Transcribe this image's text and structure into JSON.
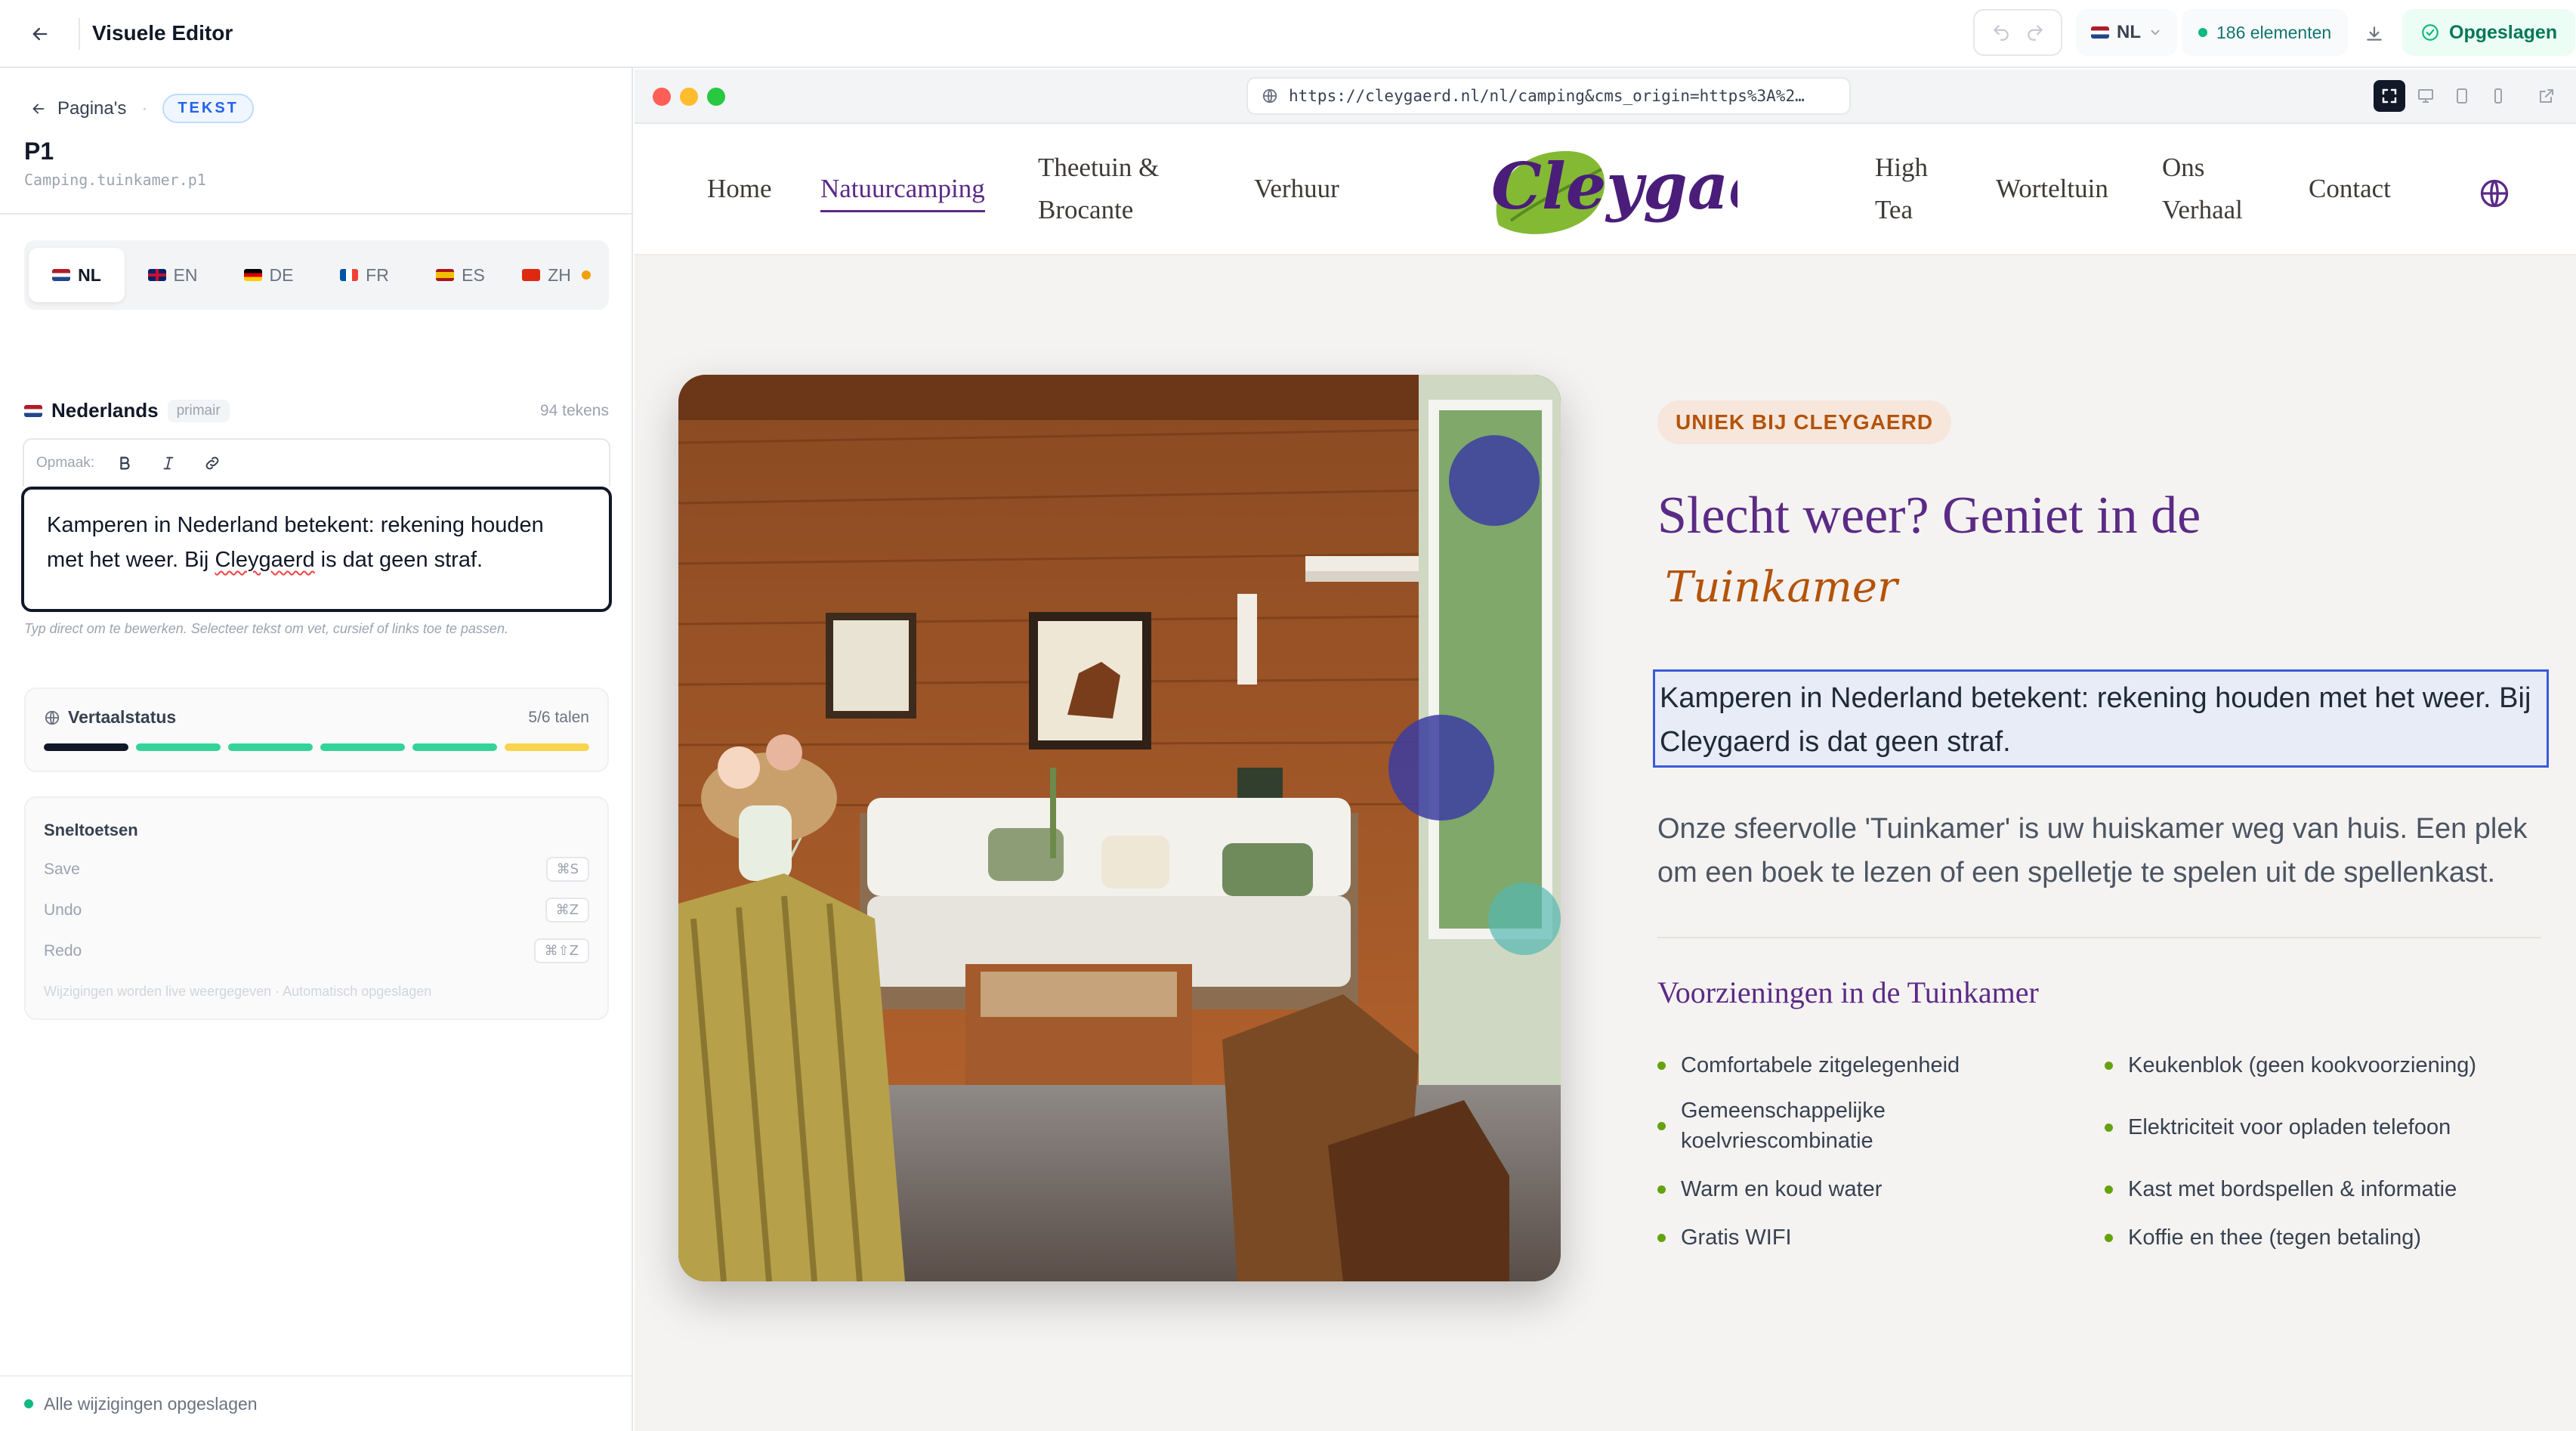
{
  "topbar": {
    "title": "Visuele Editor",
    "language": "NL",
    "element_count": "186 elementen",
    "saved_label": "Opgeslagen"
  },
  "editor": {
    "breadcrumb": "Pagina's",
    "type_badge": "TEKST",
    "element_title": "P1",
    "element_path": "Camping.tuinkamer.p1",
    "languages": [
      {
        "code": "NL",
        "active": true
      },
      {
        "code": "EN"
      },
      {
        "code": "DE"
      },
      {
        "code": "FR"
      },
      {
        "code": "ES"
      },
      {
        "code": "ZH",
        "warning": true
      }
    ],
    "current_language": "Nederlands",
    "primary_badge": "primair",
    "char_count": "94 tekens",
    "format_label": "Opmaak:",
    "text_part1": "Kamperen in Nederland betekent: rekening houden met het weer. Bij ",
    "text_word": "Cleygaerd",
    "text_part2": " is dat geen straf.",
    "hint": "Typ direct om te bewerken. Selecteer tekst om vet, cursief of links toe te passen.",
    "translation_status": {
      "title": "Vertaalstatus",
      "count": "5/6 talen",
      "bar_colors": [
        "#111827",
        "#34d399",
        "#34d399",
        "#34d399",
        "#34d399",
        "#fcd34d"
      ]
    },
    "shortcuts": {
      "title": "Sneltoetsen",
      "items": [
        {
          "label": "Save",
          "keys": "⌘S"
        },
        {
          "label": "Undo",
          "keys": "⌘Z"
        },
        {
          "label": "Redo",
          "keys": "⌘⇧Z"
        }
      ],
      "footer": "Wijzigingen worden live weergegeven · Automatisch opgeslagen"
    },
    "footer_status": "Alle wijzigingen opgeslagen"
  },
  "preview": {
    "url": "https://cleygaerd.nl/nl/camping&cms_origin=https%3A%2…",
    "nav": {
      "home": "Home",
      "natuurcamping": "Natuurcamping",
      "theetuin_1": "Theetuin &",
      "theetuin_2": "Brocante",
      "verhuur": "Verhuur",
      "logo_text": "Cleygaerd",
      "hightea_1": "High",
      "hightea_2": "Tea",
      "worteltuin": "Worteltuin",
      "verhaal_1": "Ons",
      "verhaal_2": "Verhaal",
      "contact": "Contact"
    },
    "kicker": "UNIEK BIJ CLEYGAERD",
    "heading": "Slecht weer? Geniet in de",
    "heading_script": "Tuinkamer",
    "paragraph_selected": "Kamperen in Nederland betekent: rekening houden met het weer. Bij Cleygaerd is dat geen straf.",
    "paragraph_2": "Onze sfeervolle 'Tuinkamer' is uw huiskamer weg van huis. Een plek om een boek te lezen of een spelletje te spelen uit de spellenkast.",
    "facilities_title": "Voorzieningen in de Tuinkamer",
    "facilities_left": [
      "Comfortabele zitgelegenheid",
      "Gemeenschappelijke koelvriescombinatie",
      "Warm en koud water",
      "Gratis WIFI"
    ],
    "facilities_right": [
      "Keukenblok (geen kookvoorziening)",
      "Elektriciteit voor opladen telefoon",
      "Kast met bordspellen & informatie",
      "Koffie en thee (tegen betaling)"
    ]
  }
}
